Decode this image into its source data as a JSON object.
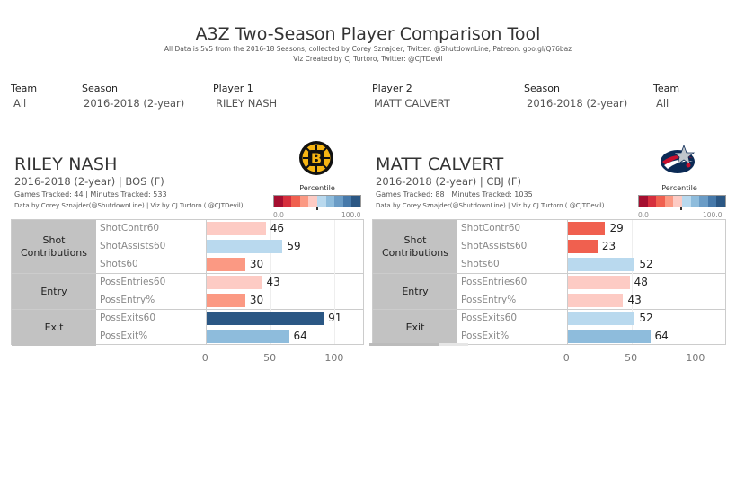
{
  "header": {
    "title": "A3Z Two-Season Player Comparison Tool",
    "subtitle1": "All Data is 5v5 from the 2016-18 Seasons, collected by Corey Sznajder, Twitter: @ShutdownLine, Patreon: goo.gl/Q76baz",
    "subtitle2": "Viz Created by CJ Turtoro, Twitter: @CJTDevil"
  },
  "filters": [
    {
      "label": "Team",
      "value": "All"
    },
    {
      "label": "Season",
      "value": "2016-2018 (2-year)"
    },
    {
      "label": "Player 1",
      "value": "RILEY NASH"
    },
    {
      "label": "Player 2",
      "value": "MATT CALVERT"
    },
    {
      "label": "Season",
      "value": "2016-2018 (2-year)"
    },
    {
      "label": "Team",
      "value": "All"
    }
  ],
  "legend": {
    "title": "Percentile",
    "min_label": "0.0",
    "max_label": "100.0",
    "colors": [
      "#a50f30",
      "#d62f3d",
      "#f0604f",
      "#fb9983",
      "#fdcbc4",
      "#b9d9ee",
      "#8ebcdc",
      "#6a9cc6",
      "#4679aa",
      "#2b5784"
    ]
  },
  "players": [
    {
      "name": "RILEY NASH",
      "season_line": "2016-2018 (2-year) | BOS (F)",
      "games_line": "Games Tracked: 44  | Minutes Tracked: 533",
      "credit_line": "Data by Corey Sznajder(@ShutdownLine) | Viz by CJ Turtoro ( @CJTDevil)",
      "team_logo": "bruins-logo-icon",
      "legend_marker": 50
    },
    {
      "name": "MATT CALVERT",
      "season_line": "2016-2018 (2-year) | CBJ (F)",
      "games_line": "Games Tracked: 88  | Minutes Tracked: 1035",
      "credit_line": "Data by Corey Sznajder(@ShutdownLine) | Viz by CJ Turtoro ( @CJTDevil)",
      "team_logo": "blue-jackets-logo-icon",
      "legend_marker": 50
    }
  ],
  "chart_data": [
    {
      "type": "bar",
      "title": "RILEY NASH",
      "xlabel": "",
      "ylabel": "",
      "xlim": [
        0,
        100
      ],
      "xticks": [
        "0",
        "50",
        "100"
      ],
      "groups": [
        {
          "name": "Shot Contributions",
          "metrics": [
            "ShotContr60",
            "ShotAssists60",
            "Shots60"
          ]
        },
        {
          "name": "Entry",
          "metrics": [
            "PossEntries60",
            "PossEntry%"
          ]
        },
        {
          "name": "Exit",
          "metrics": [
            "PossExits60",
            "PossExit%"
          ]
        }
      ],
      "categories": [
        "ShotContr60",
        "ShotAssists60",
        "Shots60",
        "PossEntries60",
        "PossEntry%",
        "PossExits60",
        "PossExit%"
      ],
      "values": [
        46,
        59,
        30,
        43,
        30,
        91,
        64
      ],
      "color_encoding": "percentile"
    },
    {
      "type": "bar",
      "title": "MATT CALVERT",
      "xlabel": "",
      "ylabel": "",
      "xlim": [
        0,
        100
      ],
      "xticks": [
        "0",
        "50",
        "100"
      ],
      "groups": [
        {
          "name": "Shot Contributions",
          "metrics": [
            "ShotContr60",
            "ShotAssists60",
            "Shots60"
          ]
        },
        {
          "name": "Entry",
          "metrics": [
            "PossEntries60",
            "PossEntry%"
          ]
        },
        {
          "name": "Exit",
          "metrics": [
            "PossExits60",
            "PossExit%"
          ]
        }
      ],
      "categories": [
        "ShotContr60",
        "ShotAssists60",
        "Shots60",
        "PossEntries60",
        "PossEntry%",
        "PossExits60",
        "PossExit%"
      ],
      "values": [
        29,
        23,
        52,
        48,
        43,
        52,
        64
      ],
      "color_encoding": "percentile"
    }
  ]
}
